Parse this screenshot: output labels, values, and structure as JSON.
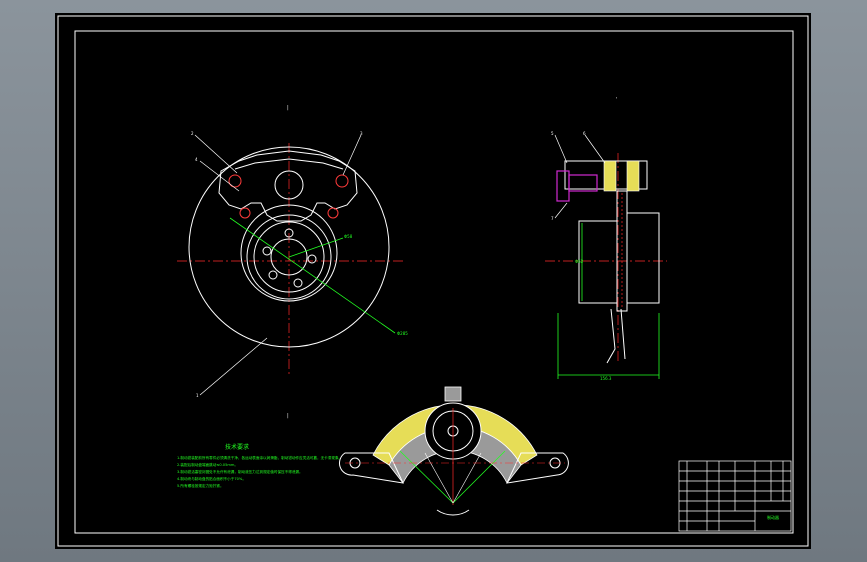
{
  "drawing": {
    "background": "#000000",
    "frame_color": "#ffffff",
    "accent_colors": {
      "centerline": "#ff2a2a",
      "dimension": "#22ff22",
      "pad_fill": "#e6dd57",
      "piston": "#d02ad0",
      "note_text": "#22ff22"
    },
    "section_marks": {
      "top_label": "|",
      "bottom_label": "|",
      "side_mark": "'"
    },
    "dimensions": {
      "inner_diameter": "Φ58",
      "outer_diameter": "Φ285",
      "hub_diameter": "Φ62",
      "overall_width": "156.3"
    },
    "part_balloons": [
      "2",
      "3",
      "1",
      "4",
      "5",
      "6",
      "7",
      "8"
    ],
    "notes": {
      "title": "技术要求",
      "lines": [
        "1.制动钳装配前所有零件必须清洗干净，各运动表面涂以润滑脂，制动钳动作应灵活可靠，无卡滞现象。",
        "2.装配后制动盘端面跳动≤0.05mm。",
        "3.制动钳活塞密封圈处不允许有泄漏，制动液压力达到规定值时保压不得泄漏。",
        "4.制动块与制动盘的贴合面积不小于70%。",
        "5.所有螺栓按规定力矩拧紧。"
      ]
    },
    "title_block": {
      "drawing_name": "制动器"
    }
  }
}
